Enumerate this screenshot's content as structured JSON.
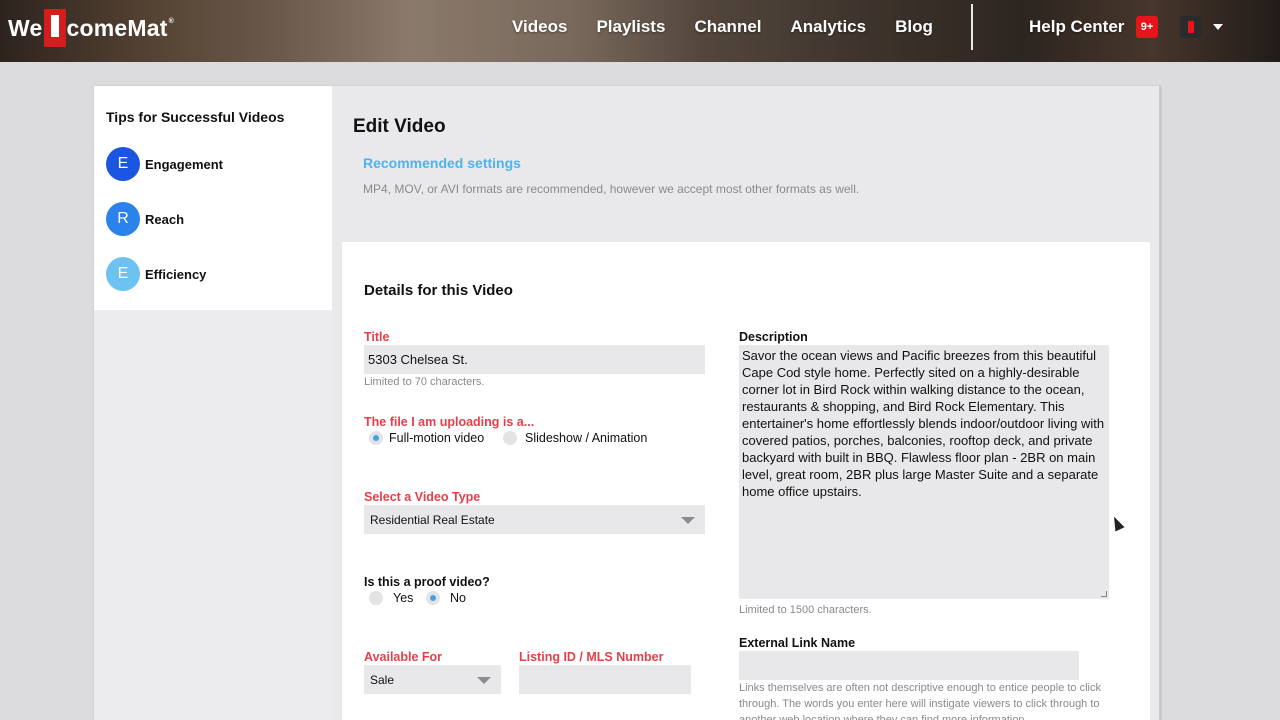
{
  "brand": {
    "logo_left": "We",
    "logo_right": "comeMat"
  },
  "nav": {
    "items": [
      "Videos",
      "Playlists",
      "Channel",
      "Analytics",
      "Blog"
    ]
  },
  "header": {
    "help_label": "Help Center",
    "notification_count": "9+"
  },
  "sidebar": {
    "title": "Tips for Successful Videos",
    "items": [
      {
        "letter": "E",
        "label": "Engagement",
        "color": "#1a56e0"
      },
      {
        "letter": "R",
        "label": "Reach",
        "color": "#2b82ea"
      },
      {
        "letter": "E",
        "label": "Efficiency",
        "color": "#6cc3f1"
      }
    ]
  },
  "main": {
    "title": "Edit Video",
    "recommended_link": "Recommended settings",
    "recommended_desc": "MP4, MOV, or AVI formats are recommended, however we accept most other formats as well."
  },
  "details": {
    "title": "Details for this Video",
    "title_field": {
      "label": "Title",
      "value": "5303 Chelsea St.",
      "hint": "Limited to 70 characters."
    },
    "file_type": {
      "label": "The file I am uploading is a...",
      "options": [
        "Full-motion video",
        "Slideshow / Animation"
      ],
      "selected": "Full-motion video"
    },
    "video_type": {
      "label": "Select a Video Type",
      "value": "Residential Real Estate"
    },
    "proof": {
      "label": "Is this a proof video?",
      "options": [
        "Yes",
        "No"
      ],
      "selected": "No"
    },
    "available_for": {
      "label": "Available For",
      "value": "Sale"
    },
    "listing_id": {
      "label": "Listing ID / MLS Number",
      "value": ""
    },
    "description": {
      "label": "Description",
      "value": "Savor the ocean views and Pacific breezes from this beautiful Cape Cod style home. Perfectly sited on a highly-desirable corner lot in Bird Rock within walking distance to the ocean, restaurants & shopping, and Bird Rock Elementary. This entertainer's home effortlessly blends indoor/outdoor living with covered patios, porches, balconies, rooftop deck, and private backyard with built in BBQ. Flawless floor plan - 2BR on main level, great room, 2BR plus large Master Suite and a separate home office upstairs.",
      "hint": "Limited to 1500 characters."
    },
    "external_link": {
      "label": "External Link Name",
      "value": "",
      "hint": "Links themselves are often not descriptive enough to entice people to click through. The words you enter here will instigate viewers to click through to another web location where they can find more information."
    }
  }
}
